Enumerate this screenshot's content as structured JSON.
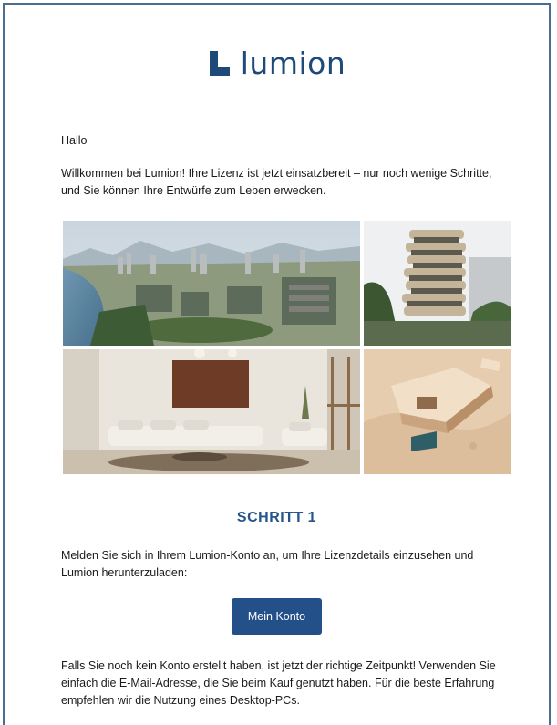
{
  "brand": {
    "name": "lumion",
    "color": "#1e4a7a",
    "logo_icon": "lumion-logo-icon"
  },
  "email": {
    "greeting": "Hallo",
    "intro": "Willkommen bei Lumion! Ihre Lizenz ist jetzt einsatzbereit – nur noch wenige Schritte, und Sie können Ihre Entwürfe zum Leben erwecken.",
    "gallery": [
      {
        "subject": "city-render-image"
      },
      {
        "subject": "tower-render-image"
      },
      {
        "subject": "interior-render-image"
      },
      {
        "subject": "architectural-model-image"
      }
    ],
    "step": {
      "heading": "SCHRITT 1",
      "text": "Melden Sie sich in Ihrem Lumion-Konto an, um Ihre Lizenzdetails einzusehen und Lumion herunterzuladen:",
      "button_label": "Mein Konto",
      "heading_color": "#25558a",
      "button_color": "#24508a"
    },
    "footer_text": "Falls Sie noch kein Konto erstellt haben, ist jetzt der richtige Zeitpunkt! Verwenden Sie einfach die E-Mail-Adresse, die Sie beim Kauf genutzt haben. Für die beste Erfahrung empfehlen wir die Nutzung eines Desktop-PCs."
  },
  "frame_border_color": "#4a6d92"
}
